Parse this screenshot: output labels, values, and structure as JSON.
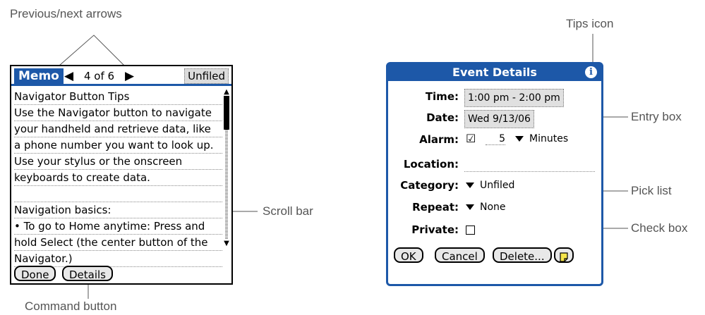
{
  "callouts": {
    "prev_next_arrows": "Previous/next arrows",
    "tips_icon": "Tips icon",
    "entry_box": "Entry box",
    "pick_list": "Pick list",
    "scroll_bar": "Scroll bar",
    "check_box": "Check box",
    "command_button": "Command button"
  },
  "memo": {
    "title": "Memo",
    "counter": "4 of 6",
    "category": "Unfiled",
    "lines": [
      "Navigator Button Tips",
      "Use the Navigator button to navigate",
      "your handheld and retrieve data, like",
      "a phone number you want to look up.",
      "Use your stylus or the onscreen",
      "keyboards to create data.",
      "",
      "Navigation basics:",
      "• To go to Home anytime: Press and",
      "hold Select (the center button of the",
      "Navigator.)"
    ],
    "buttons": {
      "done": "Done",
      "details": "Details"
    }
  },
  "event": {
    "title": "Event Details",
    "labels": {
      "time": "Time:",
      "date": "Date:",
      "alarm": "Alarm:",
      "location": "Location:",
      "category": "Category:",
      "repeat": "Repeat:",
      "private": "Private:"
    },
    "time": "1:00 pm - 2:00 pm",
    "date": "Wed 9/13/06",
    "alarm_checked": "☑",
    "alarm_amount": "5",
    "alarm_unit": "Minutes",
    "location": "",
    "category": "Unfiled",
    "repeat": "None",
    "buttons": {
      "ok": "OK",
      "cancel": "Cancel",
      "delete": "Delete...",
      "note_icon": "note-icon"
    }
  },
  "colors": {
    "accent": "#1d58a8",
    "callout_text": "#555555"
  }
}
